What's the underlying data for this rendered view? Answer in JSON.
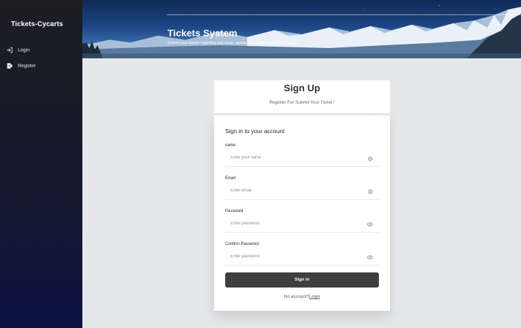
{
  "sidebar": {
    "brand": "Tickets-Cycarts",
    "items": [
      {
        "label": "Login",
        "icon": "login-icon"
      },
      {
        "label": "Register",
        "icon": "register-icon"
      }
    ]
  },
  "hero": {
    "title": "Tickets System",
    "subtitle": "Submit your tickets regarding any issue, update your issue & delete your issue !"
  },
  "header_card": {
    "title": "Sign Up",
    "subtitle": "Register For Submit Your Ticket !"
  },
  "form": {
    "title": "Sign in to your account",
    "fields": [
      {
        "label": "name",
        "placeholder": "Enter your name",
        "value": "",
        "icon": "at-icon"
      },
      {
        "label": "Email",
        "placeholder": "Enter email",
        "value": "",
        "icon": "at-icon"
      },
      {
        "label": "Password",
        "placeholder": "Enter password",
        "value": "",
        "icon": "eye-icon"
      },
      {
        "label": "Confirm Password",
        "placeholder": "Enter password",
        "value": "",
        "icon": "eye-icon"
      }
    ],
    "submit_label": "Sign in",
    "footer_text": "No account?",
    "footer_link": "Login"
  },
  "colors": {
    "sidebar_bottom": "#0c1242",
    "button": "#3e3e3e",
    "page_bg": "#e6e7ea"
  }
}
